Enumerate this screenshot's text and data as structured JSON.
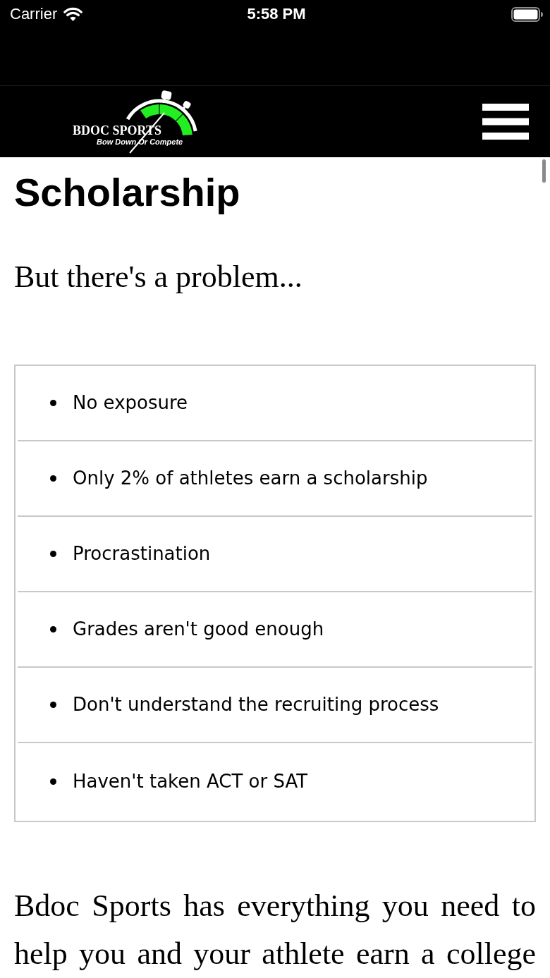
{
  "status_bar": {
    "carrier": "Carrier",
    "time": "5:58 PM"
  },
  "header": {
    "logo": {
      "name": "BDOC SPORTS",
      "tagline": "Bow Down Or Compete"
    }
  },
  "page": {
    "title": "Scholarship",
    "subtitle": "But there's a problem...",
    "problems": [
      "No exposure",
      "Only 2% of athletes earn a scholarship",
      "Procrastination",
      "Grades aren't good enough",
      "Don't understand the recruiting process",
      "Haven't taken ACT or SAT"
    ],
    "paragraph": "Bdoc Sports has everything you need to help you and your athlete earn a college"
  }
}
